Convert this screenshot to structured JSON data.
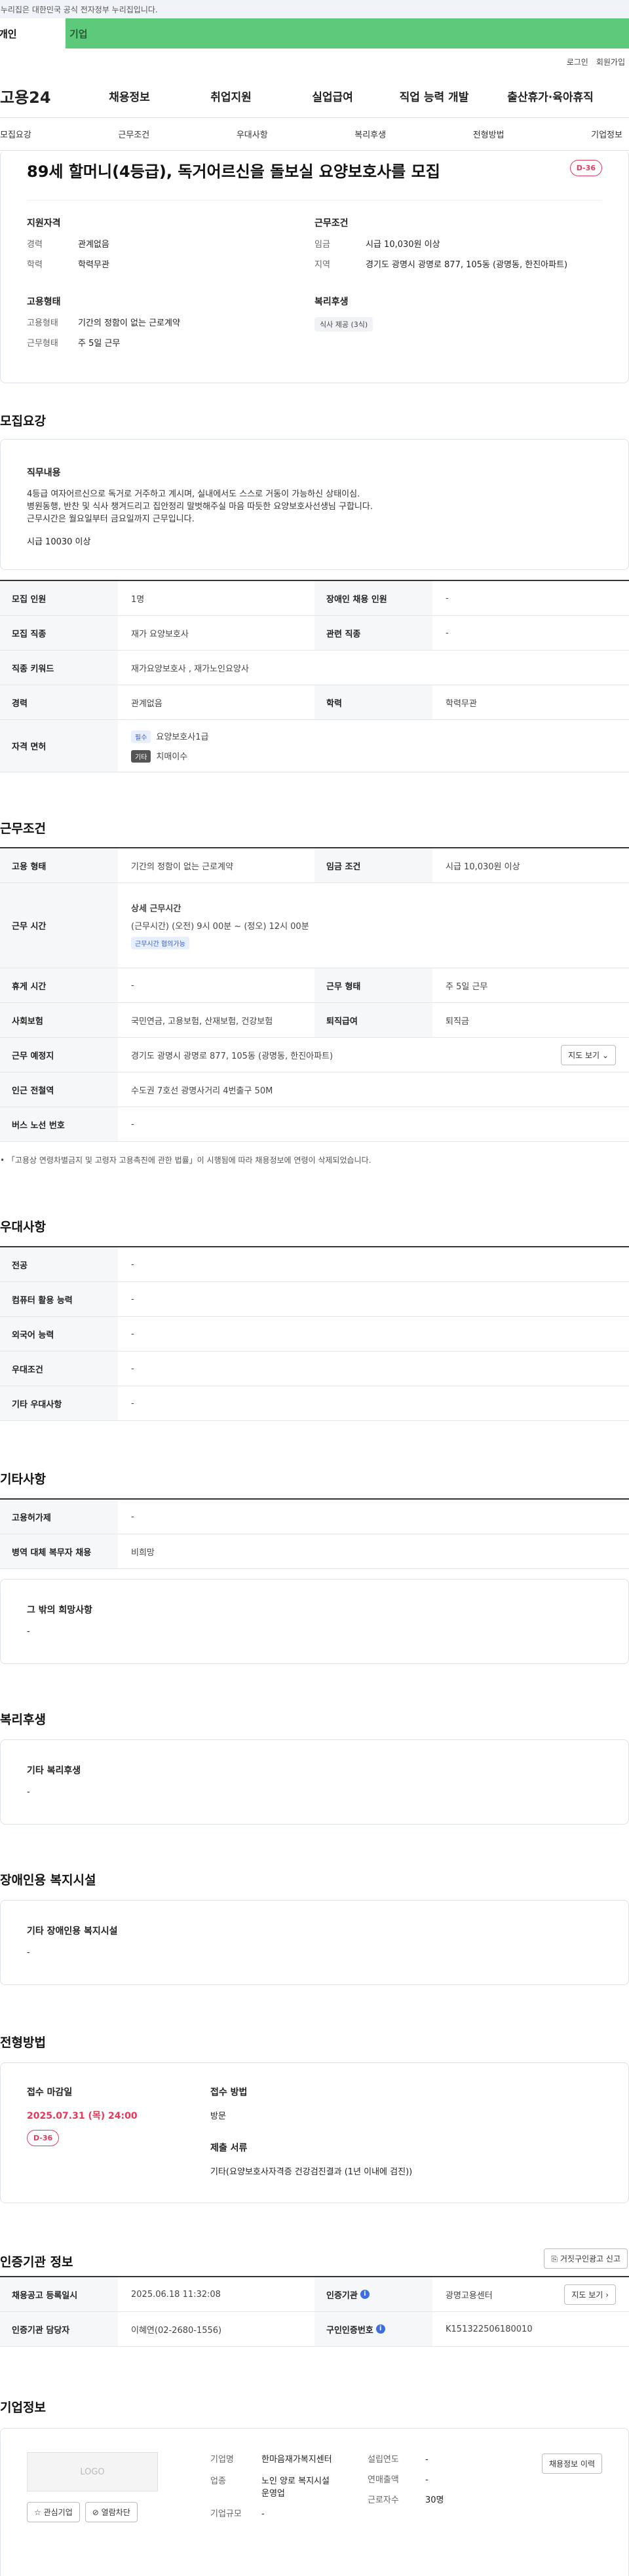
{
  "topbar": {
    "notice": "이 누리집은 대한민국 공식 전자정부 누리집입니다."
  },
  "audience": {
    "individual": "개인",
    "corporate": "기업"
  },
  "util": {
    "login": "로그인",
    "signup": "회원가입"
  },
  "gnb": {
    "logo": "고용24",
    "items": [
      "채용정보",
      "취업지원",
      "실업급여",
      "직업 능력 개발",
      "출산휴가·육아휴직"
    ]
  },
  "anchor": {
    "items": [
      "모집요강",
      "근무조건",
      "우대사항",
      "복리후생",
      "전형방법",
      "기업정보"
    ]
  },
  "job": {
    "title": "89세 할머니(4등급), 독거어르신을 돌보실 요양보호사를 모집",
    "dday": "D-36",
    "qual": {
      "heading": "지원자격",
      "career_k": "경력",
      "career_v": "관계없음",
      "edu_k": "학력",
      "edu_v": "학력무관"
    },
    "cond": {
      "heading": "근무조건",
      "wage_k": "임금",
      "wage_v": "시급 10,030원 이상",
      "region_k": "지역",
      "region_v": "경기도 광명시 광명로 877, 105동 (광명동, 한진아파트)"
    },
    "emp": {
      "heading": "고용형태",
      "type_k": "고용형태",
      "type_v": "기간의 정함이 없는 근로계약",
      "form_k": "근무형태",
      "form_v": "주 5일 근무"
    },
    "welfare": {
      "heading": "복리후생",
      "chip": "식사 제공 (3식)"
    }
  },
  "recruit": {
    "title": "모집요강",
    "duty_heading": "직무내용",
    "duty_lines": [
      "4등급 여자어르신으로 독거로 거주하고 계시며, 실내에서도 스스로 거동이 가능하신 상태이심.",
      "병원동행, 반찬 및 식사 챙겨드리고 집안정리 말벗해주실 마음 따듯한 요양보호사선생님 구합니다.",
      "근무시간은  월요일부터 금요일까지 근무입니다."
    ],
    "duty_wage": "시급 10030  이상",
    "rows": {
      "count_k": "모집 인원",
      "count_v": "1명",
      "dis_k": "장애인 채용 인원",
      "dis_v": "-",
      "job_k": "모집 직종",
      "job_v": "재가 요양보호사",
      "rel_k": "관련 직종",
      "rel_v": "-",
      "kw_k": "직종 키워드",
      "kw_v": "재가요양보호사 , 재가노인요양사",
      "car_k": "경력",
      "car_v": "관계없음",
      "edu_k": "학력",
      "edu_v": "학력무관",
      "lic_k": "자격 면허",
      "lic_badge1": "필수",
      "lic_v1": "요양보호사1급",
      "lic_badge2": "기타",
      "lic_v2": "치매이수"
    }
  },
  "work": {
    "title": "근무조건",
    "type_k": "고용 형태",
    "type_v": "기간의 정함이 없는 근로계약",
    "wage_k": "임금 조건",
    "wage_v": "시급 10,030원 이상",
    "hours_k": "근무 시간",
    "hours_h": "상세 근무시간",
    "hours_v": "(근무시간) (오전) 9시 00분 ~ (정오) 12시 00분",
    "hours_chip": "근무시간 협의가능",
    "rest_k": "휴게 시간",
    "rest_v": "-",
    "form_k": "근무 형태",
    "form_v": "주 5일 근무",
    "ins_k": "사회보험",
    "ins_v": "국민연금, 고용보험, 산재보험, 건강보험",
    "ret_k": "퇴직급여",
    "ret_v": "퇴직금",
    "loc_k": "근무 예정지",
    "loc_v": "경기도 광명시 광명로 877, 105동 (광명동, 한진아파트)",
    "map_btn": "지도 보기",
    "sub_k": "인근 전철역",
    "sub_v": "수도권 7호선 광명사거리 4번출구 50M",
    "bus_k": "버스 노선 번호",
    "bus_v": "-",
    "note": "「고용상 연령차별금지 및 고령자 고용촉진에 관한 법률」이 시행됨에 따라 채용정보에 연령이 삭제되었습니다."
  },
  "pref": {
    "title": "우대사항",
    "major_k": "전공",
    "major_v": "-",
    "pc_k": "컴퓨터 활용 능력",
    "pc_v": "-",
    "lang_k": "외국어 능력",
    "lang_v": "-",
    "cond_k": "우대조건",
    "cond_v": "-",
    "etc_k": "기타 우대사항",
    "etc_v": "-"
  },
  "other": {
    "title": "기타사항",
    "dev_k": "고용허가제",
    "dev_v": "-",
    "mil_k": "병역 대체 복무자 채용",
    "mil_v": "비희망",
    "wish_h": "그 밖의 희망사항",
    "wish_v": "-"
  },
  "benefit": {
    "title": "복리후생",
    "h": "기타 복리후생",
    "v": "-"
  },
  "disab": {
    "title": "장애인용 복지시설",
    "h": "기타 장애인용 복지시설",
    "v": "-"
  },
  "screen": {
    "title": "전형방법",
    "dl_h": "접수 마감일",
    "dl_v": "2025.07.31 (목) 24:00",
    "dday": "D-36",
    "method_h": "접수 방법",
    "method_v": "방문",
    "doc_h": "제출 서류",
    "doc_v": "기타(요양보호사자격증 건강검진결과 (1년 이내에 검진))"
  },
  "agency": {
    "title": "인증기관 정보",
    "report_btn": "거짓구인광고 신고",
    "reg_k": "채용공고 등록일시",
    "reg_v": "2025.06.18 11:32:08",
    "org_k": "인증기관",
    "org_v": "광명고용센터",
    "map_btn": "지도 보기",
    "mgr_k": "인증기관 담당자",
    "mgr_v": "이혜연(02-2680-1556)",
    "num_k": "구인인증번호",
    "num_v": "K151322506180010"
  },
  "company": {
    "title": "기업정보",
    "logo": "LOGO",
    "fav_btn": "관심기업",
    "block_btn": "열람차단",
    "info_btn": "채용정보 이력",
    "name_k": "기업명",
    "name_v": "한마음재가복지센터",
    "est_k": "설립연도",
    "est_v": "-",
    "sales_k": "연매출액",
    "sales_v": "-",
    "ind_k": "업종",
    "ind_v": "노인 양로 복지시설 운영업",
    "emp_k": "근로자수",
    "emp_v": "30명",
    "size_k": "기업규모",
    "size_v": "-"
  },
  "colors": {
    "accent": "#e5395a",
    "corp_green": "#5cc97b",
    "info_blue": "#3b6ee0"
  }
}
